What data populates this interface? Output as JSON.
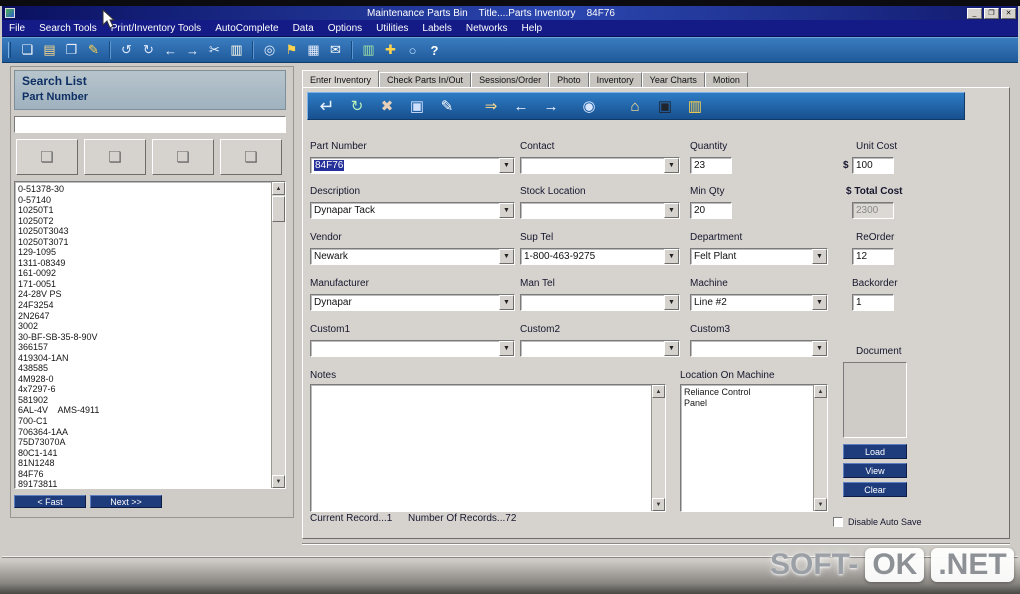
{
  "window": {
    "title": "Maintenance Parts Bin    Title....Parts Inventory    84F76",
    "controls": {
      "minimize": "_",
      "maximize": "❐",
      "close": "✕"
    }
  },
  "menu_bar": {
    "items": [
      "File",
      "Search Tools",
      "Print/Inventory Tools",
      "AutoComplete",
      "Data",
      "Options",
      "Utilities",
      "Labels",
      "Networks",
      "Help"
    ]
  },
  "toolbar": {
    "icons": [
      {
        "name": "new-doc-icon",
        "glyph": "❏"
      },
      {
        "name": "open-folder-icon",
        "glyph": "▤"
      },
      {
        "name": "copy-icon",
        "glyph": "❐"
      },
      {
        "name": "pencil-icon",
        "glyph": "✎"
      },
      {
        "name": "undo-icon",
        "glyph": "↺"
      },
      {
        "name": "redo-icon",
        "glyph": "↻"
      },
      {
        "name": "back-arrow-icon",
        "glyph": "←"
      },
      {
        "name": "forward-arrow-icon",
        "glyph": "→"
      },
      {
        "name": "cut-icon",
        "glyph": "✂"
      },
      {
        "name": "paste-icon",
        "glyph": "▥"
      },
      {
        "name": "search-icon",
        "glyph": "◎"
      },
      {
        "name": "flag-icon",
        "glyph": "⚑"
      },
      {
        "name": "print-icon",
        "glyph": "▦"
      },
      {
        "name": "mail-icon",
        "glyph": "✉"
      },
      {
        "name": "chart-icon",
        "glyph": "▥"
      },
      {
        "name": "tools-icon",
        "glyph": "✚"
      },
      {
        "name": "globe-icon",
        "glyph": "○"
      },
      {
        "name": "help-icon",
        "glyph": "?"
      }
    ]
  },
  "search_panel": {
    "title_line1": "Search List",
    "title_line2": "Part Number",
    "search_value": "",
    "buttons": [
      {
        "name": "list-edit-button",
        "glyph": "❏",
        "accent": "✎"
      },
      {
        "name": "list-send-button",
        "glyph": "❏",
        "accent": "→"
      },
      {
        "name": "list-find-button",
        "glyph": "❏",
        "accent": "◎"
      },
      {
        "name": "list-export-button",
        "glyph": "❏",
        "accent": "↘"
      }
    ],
    "list_items": [
      "0-51378-30",
      "0-57140",
      "10250T1",
      "10250T2",
      "10250T3043",
      "10250T3071",
      "129-1095",
      "1311-08349",
      "161-0092",
      "171-0051",
      "24-28V PS",
      "24F3254",
      "2N2647",
      "3002",
      "30-BF-SB-35-8-90V",
      "366157",
      "419304-1AN",
      "438585",
      "4M928-0",
      "4x7297-6",
      "581902",
      "6AL-4V    AMS-4911",
      "700-C1",
      "706364-1AA",
      "75D73070A",
      "80C1-141",
      "81N1248",
      "84F76",
      "89173811"
    ],
    "fast_button": "< Fast",
    "next_button": "Next >>"
  },
  "tabs": {
    "items": [
      "Enter Inventory",
      "Check Parts In/Out",
      "Sessions/Order",
      "Photo",
      "Inventory",
      "Year Charts",
      "Motion"
    ],
    "active": "Enter Inventory"
  },
  "inner_toolbar": {
    "icons": [
      {
        "name": "post-record-icon",
        "glyph": "↵"
      },
      {
        "name": "refresh-icon",
        "glyph": "↻"
      },
      {
        "name": "delete-record-icon",
        "glyph": "✖"
      },
      {
        "name": "save-record-icon",
        "glyph": "▣"
      },
      {
        "name": "edit-record-icon",
        "glyph": "✎"
      },
      {
        "name": "exit-icon",
        "glyph": "⇒"
      },
      {
        "name": "prev-record-icon",
        "glyph": "←"
      },
      {
        "name": "next-record-icon",
        "glyph": "→"
      },
      {
        "name": "view-record-icon",
        "glyph": "◉"
      },
      {
        "name": "home-icon",
        "glyph": "⌂"
      },
      {
        "name": "photo-icon",
        "glyph": "▣"
      },
      {
        "name": "chart-icon",
        "glyph": "▥"
      }
    ]
  },
  "form": {
    "part_number": {
      "label": "Part Number",
      "value": "84F76"
    },
    "contact": {
      "label": "Contact",
      "value": ""
    },
    "quantity": {
      "label": "Quantity",
      "value": "23"
    },
    "unit_cost": {
      "label": "Unit Cost",
      "prefix": "$",
      "value": "100"
    },
    "description": {
      "label": "Description",
      "value": "Dynapar Tack"
    },
    "stock_location": {
      "label": "Stock Location",
      "value": ""
    },
    "min_qty": {
      "label": "Min Qty",
      "value": "20"
    },
    "total_cost": {
      "label": "$ Total Cost",
      "value": "2300"
    },
    "vendor": {
      "label": "Vendor",
      "value": "Newark"
    },
    "sup_tel": {
      "label": "Sup Tel",
      "value": "1-800-463-9275"
    },
    "department": {
      "label": "Department",
      "value": "Felt Plant"
    },
    "reorder": {
      "label": "ReOrder",
      "value": "12"
    },
    "manufacturer": {
      "label": "Manufacturer",
      "value": "Dynapar"
    },
    "man_tel": {
      "label": "Man Tel",
      "value": ""
    },
    "machine": {
      "label": "Machine",
      "value": "Line #2"
    },
    "backorder": {
      "label": "Backorder",
      "value": "1"
    },
    "custom1": {
      "label": "Custom1",
      "value": ""
    },
    "custom2": {
      "label": "Custom2",
      "value": ""
    },
    "custom3": {
      "label": "Custom3",
      "value": ""
    },
    "notes": {
      "label": "Notes",
      "value": ""
    },
    "location_on_machine": {
      "label": "Location On Machine",
      "lines": [
        "Reliance Control",
        "Panel"
      ]
    },
    "document": {
      "label": "Document",
      "load": "Load",
      "view": "View",
      "clear": "Clear"
    }
  },
  "status": {
    "current_record": "Current Record...1",
    "record_count": "Number Of Records...72",
    "auto_save_label": "Disable Auto Save"
  },
  "watermark": {
    "part1": "SOFT-",
    "part2": "OK",
    "part3": ".NET"
  },
  "ui": {
    "dropdown_glyph": "▼",
    "scroll_up": "▲",
    "scroll_down": "▼"
  }
}
